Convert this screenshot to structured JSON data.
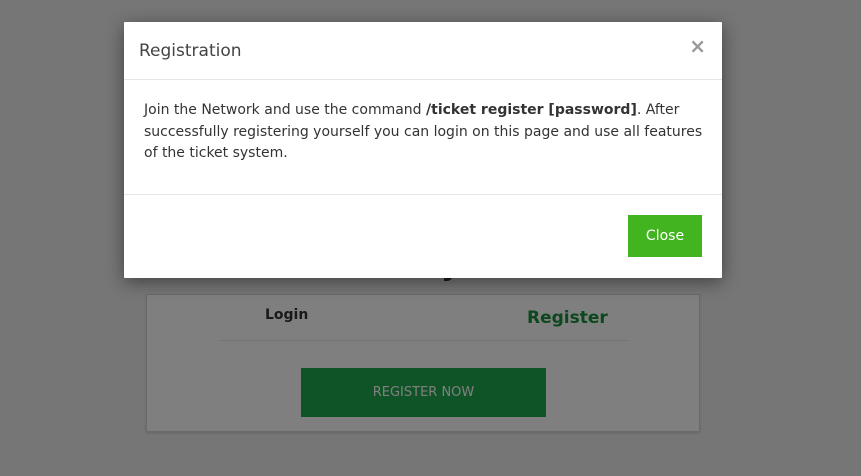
{
  "page": {
    "title_partial": "TicketSystem",
    "tabs": [
      {
        "label": "Login"
      },
      {
        "label": "Register"
      }
    ],
    "register_button_label": "REGISTER NOW"
  },
  "modal": {
    "title": "Registration",
    "close_glyph": "×",
    "body": {
      "text_before": "Join the Network and use the command ",
      "command": "/ticket register [password]",
      "text_after": ". After successfully registering yourself you can login on this page and use all features of the ticket system."
    },
    "close_button_label": "Close"
  },
  "colors": {
    "accent_green": "#42b41f",
    "register_tab_green": "#1a8f3c",
    "register_button_green": "#1fa84f"
  }
}
